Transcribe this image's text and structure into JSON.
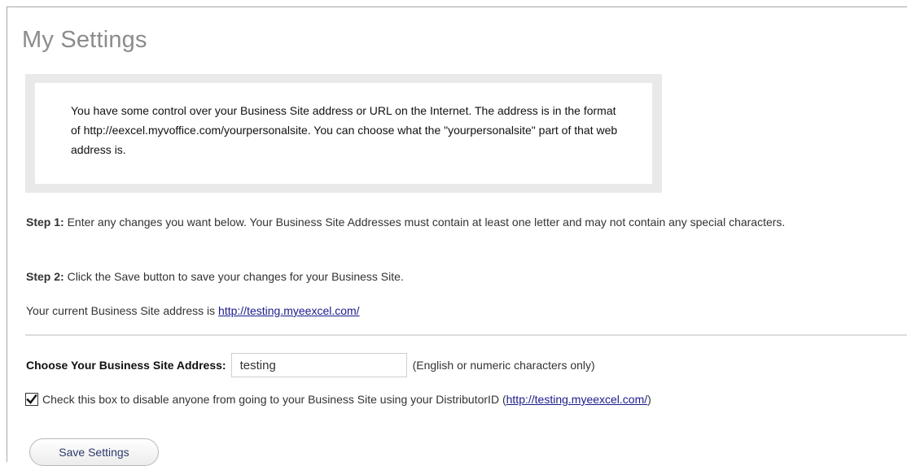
{
  "page": {
    "title": "My Settings"
  },
  "info": {
    "text": "You have some control over your Business Site address or URL on the Internet. The address is in the format of http://eexcel.myvoffice.com/yourpersonalsite. You can choose what the \"yourpersonalsite\" part of that web address is."
  },
  "steps": {
    "step1_label": "Step 1:",
    "step1_text": " Enter any changes you want below. Your Business Site Addresses must contain at least one letter and may not contain any special characters.",
    "step2_label": "Step 2:",
    "step2_text": " Click the Save button to save your changes for your Business Site."
  },
  "current": {
    "prefix": "Your current Business Site address is ",
    "url": "http://testing.myeexcel.com/"
  },
  "form": {
    "address_label": "Choose Your Business Site Address:",
    "address_value": "testing",
    "address_hint": "(English or numeric characters only)",
    "checkbox_checked": true,
    "checkbox_label_prefix": "Check this box to disable anyone from going to your Business Site using your DistributorID (",
    "checkbox_link": "http://testing.myeexcel.com/",
    "checkbox_label_suffix": ")",
    "save_label": "Save Settings"
  }
}
